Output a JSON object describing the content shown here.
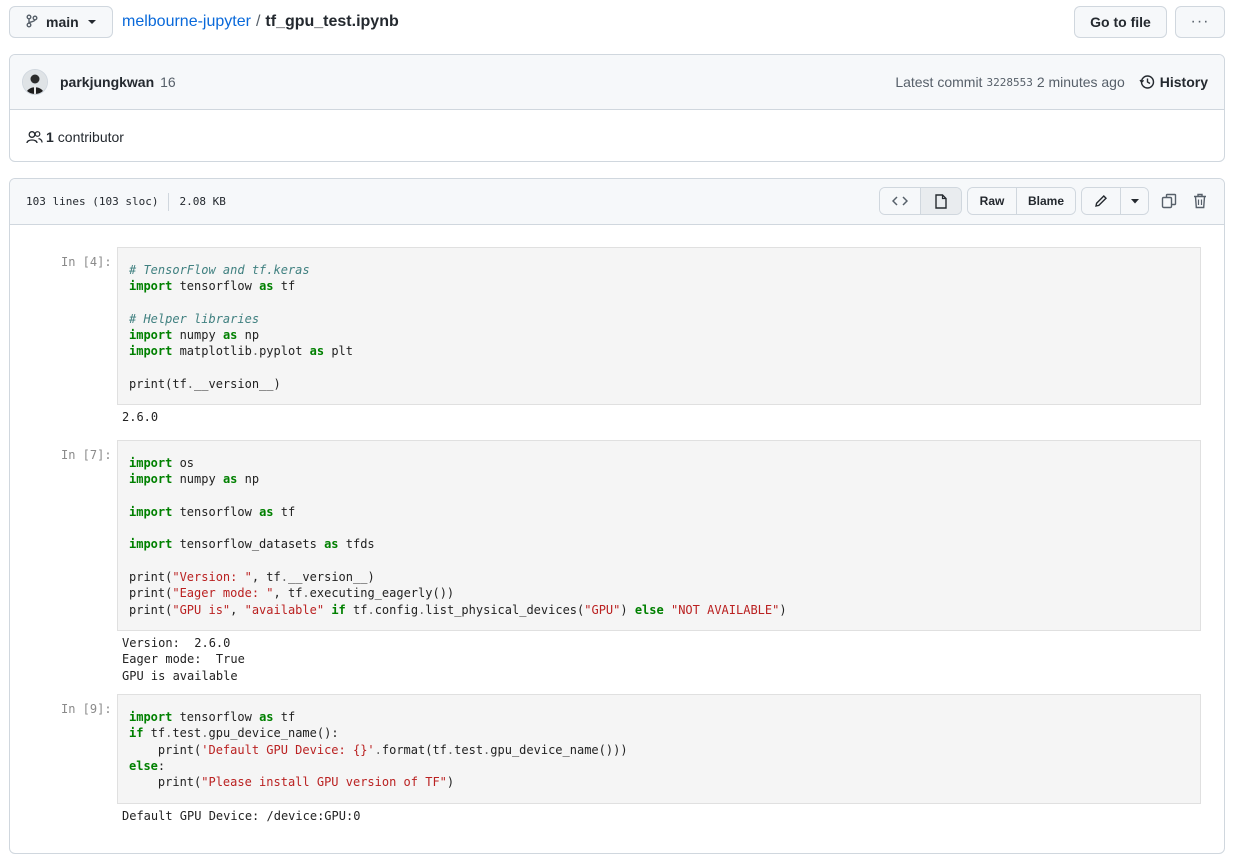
{
  "top_bar": {
    "branch": "main",
    "repo": "melbourne-jupyter",
    "separator": "/",
    "file": "tf_gpu_test.ipynb",
    "go_to_file": "Go to file",
    "more": "···"
  },
  "commit": {
    "author": "parkjungkwan",
    "commit_count": "16",
    "latest_label": "Latest commit",
    "sha": "3228553",
    "time": "2 minutes ago",
    "history": "History",
    "contributors_count": "1",
    "contributors_label": "contributor"
  },
  "file_info": {
    "lines": "103 lines (103 sloc)",
    "size": "2.08 KB",
    "raw": "Raw",
    "blame": "Blame"
  },
  "notebook": {
    "cells": [
      {
        "prompt": "In [4]:",
        "lines": [
          [
            [
              "cm",
              "# TensorFlow and tf.keras"
            ]
          ],
          [
            [
              "kw",
              "import"
            ],
            [
              "",
              " tensorflow "
            ],
            [
              "kw",
              "as"
            ],
            [
              "",
              " tf"
            ]
          ],
          [],
          [
            [
              "cm",
              "# Helper libraries"
            ]
          ],
          [
            [
              "kw",
              "import"
            ],
            [
              "",
              " numpy "
            ],
            [
              "kw",
              "as"
            ],
            [
              "",
              " np"
            ]
          ],
          [
            [
              "kw",
              "import"
            ],
            [
              "",
              " matplotlib"
            ],
            [
              "op",
              "."
            ],
            [
              "",
              "pyplot "
            ],
            [
              "kw",
              "as"
            ],
            [
              "",
              " plt"
            ]
          ],
          [],
          [
            [
              "",
              "print(tf"
            ],
            [
              "op",
              "."
            ],
            [
              "",
              "__version__)"
            ]
          ]
        ],
        "output": [
          "2.6.0"
        ]
      },
      {
        "prompt": "In [7]:",
        "lines": [
          [
            [
              "kw",
              "import"
            ],
            [
              "",
              " os"
            ]
          ],
          [
            [
              "kw",
              "import"
            ],
            [
              "",
              " numpy "
            ],
            [
              "kw",
              "as"
            ],
            [
              "",
              " np"
            ]
          ],
          [],
          [
            [
              "kw",
              "import"
            ],
            [
              "",
              " tensorflow "
            ],
            [
              "kw",
              "as"
            ],
            [
              "",
              " tf"
            ]
          ],
          [],
          [
            [
              "kw",
              "import"
            ],
            [
              "",
              " tensorflow_datasets "
            ],
            [
              "kw",
              "as"
            ],
            [
              "",
              " tfds"
            ]
          ],
          [],
          [
            [
              "",
              "print("
            ],
            [
              "st",
              "\"Version: \""
            ],
            [
              "",
              ", tf"
            ],
            [
              "op",
              "."
            ],
            [
              "",
              "__version__)"
            ]
          ],
          [
            [
              "",
              "print("
            ],
            [
              "st",
              "\"Eager mode: \""
            ],
            [
              "",
              ", tf"
            ],
            [
              "op",
              "."
            ],
            [
              "",
              "executing_eagerly())"
            ]
          ],
          [
            [
              "",
              "print("
            ],
            [
              "st",
              "\"GPU is\""
            ],
            [
              "",
              ", "
            ],
            [
              "st",
              "\"available\""
            ],
            [
              "",
              " "
            ],
            [
              "kw",
              "if"
            ],
            [
              "",
              " tf"
            ],
            [
              "op",
              "."
            ],
            [
              "",
              "config"
            ],
            [
              "op",
              "."
            ],
            [
              "",
              "list_physical_devices("
            ],
            [
              "st",
              "\"GPU\""
            ],
            [
              "",
              ") "
            ],
            [
              "kw",
              "else"
            ],
            [
              "",
              " "
            ],
            [
              "st",
              "\"NOT AVAILABLE\""
            ],
            [
              "",
              ")"
            ]
          ]
        ],
        "output": [
          "Version:  2.6.0",
          "Eager mode:  True",
          "GPU is available"
        ]
      },
      {
        "prompt": "In [9]:",
        "lines": [
          [
            [
              "kw",
              "import"
            ],
            [
              "",
              " tensorflow "
            ],
            [
              "kw",
              "as"
            ],
            [
              "",
              " tf"
            ]
          ],
          [
            [
              "kw",
              "if"
            ],
            [
              "",
              " tf"
            ],
            [
              "op",
              "."
            ],
            [
              "",
              "test"
            ],
            [
              "op",
              "."
            ],
            [
              "",
              "gpu_device_name():"
            ]
          ],
          [
            [
              "",
              "    print("
            ],
            [
              "st",
              "'Default GPU Device: {}'"
            ],
            [
              "op",
              "."
            ],
            [
              "",
              "format(tf"
            ],
            [
              "op",
              "."
            ],
            [
              "",
              "test"
            ],
            [
              "op",
              "."
            ],
            [
              "",
              "gpu_device_name()))"
            ]
          ],
          [
            [
              "kw",
              "else"
            ],
            [
              "",
              ":"
            ]
          ],
          [
            [
              "",
              "    print("
            ],
            [
              "st",
              "\"Please install GPU version of TF\""
            ],
            [
              "",
              ")"
            ]
          ]
        ],
        "output": [
          "Default GPU Device: /device:GPU:0"
        ]
      }
    ]
  }
}
